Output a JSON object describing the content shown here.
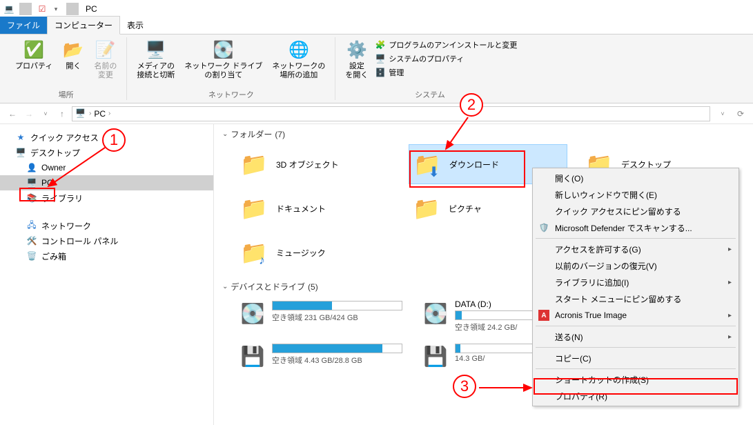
{
  "window": {
    "title": "PC"
  },
  "tabs": {
    "file": "ファイル",
    "computer": "コンピューター",
    "view": "表示"
  },
  "ribbon": {
    "location": {
      "properties": "プロパティ",
      "open": "開く",
      "rename": "名前の\n変更",
      "group": "場所"
    },
    "network": {
      "media": "メディアの\n接続と切断",
      "map_drive": "ネットワーク ドライブ\nの割り当て",
      "add_location": "ネットワークの\n場所の追加",
      "group": "ネットワーク"
    },
    "system": {
      "settings": "設定\nを開く",
      "uninstall": "プログラムのアンインストールと変更",
      "sysprops": "システムのプロパティ",
      "manage": "管理",
      "group": "システム"
    }
  },
  "address": {
    "location": "PC"
  },
  "navtree": {
    "quick_access": "クイック アクセス",
    "desktop": "デスクトップ",
    "owner": "Owner",
    "pc": "PC",
    "libraries": "ライブラリ",
    "network": "ネットワーク",
    "control_panel": "コントロール パネル",
    "recycle_bin": "ごみ箱"
  },
  "sections": {
    "folders": {
      "label": "フォルダー",
      "count": "(7)"
    },
    "drives": {
      "label": "デバイスとドライブ",
      "count": "(5)"
    }
  },
  "folders": {
    "objects3d": "3D オブジェクト",
    "downloads": "ダウンロード",
    "desktop": "デスクトップ",
    "documents": "ドキュメント",
    "pictures": "ピクチャ",
    "music": "ミュージック"
  },
  "drives": [
    {
      "name": "",
      "free": "空き領域 231 GB/424 GB",
      "fill": 46
    },
    {
      "name": "DATA (D:)",
      "free": "空き領域 24.2 GB/",
      "fill": 5
    },
    {
      "name": "",
      "free": "空き領域 4.43 GB/28.8 GB",
      "fill": 85
    },
    {
      "name": "",
      "free": "14.3 GB/",
      "fill": 4
    }
  ],
  "context_menu": {
    "open": "開く(O)",
    "open_new_window": "新しいウィンドウで開く(E)",
    "pin_quick_access": "クイック アクセスにピン留めする",
    "defender_scan": "Microsoft Defender でスキャンする...",
    "grant_access": "アクセスを許可する(G)",
    "restore_versions": "以前のバージョンの復元(V)",
    "add_to_library": "ライブラリに追加(I)",
    "pin_start": "スタート メニューにピン留めする",
    "acronis": "Acronis True Image",
    "send_to": "送る(N)",
    "copy": "コピー(C)",
    "create_shortcut": "ショートカットの作成(S)",
    "properties": "プロパティ(R)"
  },
  "annotations": {
    "step1": "1",
    "step2": "2",
    "step3": "3"
  }
}
